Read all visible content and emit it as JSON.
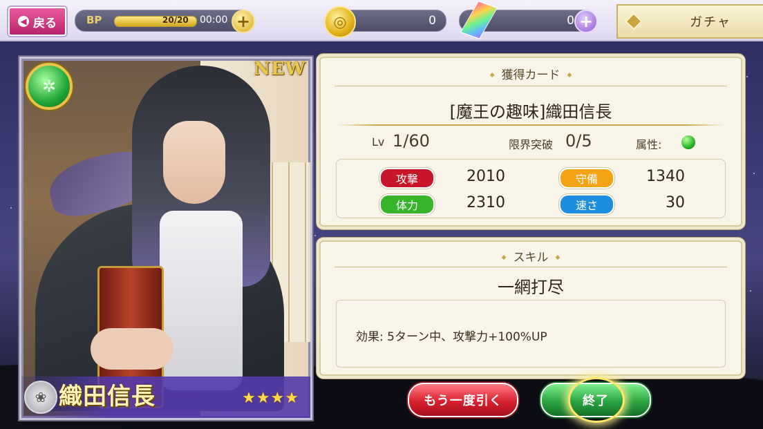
{
  "topbar": {
    "back_label": "戻る",
    "bp_label": "BP",
    "bp_value": "20/20",
    "bp_fraction": 1.0,
    "bp_timer": "00:00",
    "coin_value": "0",
    "gem_value": "0",
    "gacha_label": "ガチャ"
  },
  "card_art": {
    "new_badge": "NEW",
    "character_name": "織田信長",
    "rarity_stars": "★★★★",
    "attribute_color": "#2db52e"
  },
  "acquired_card": {
    "section_title": "獲得カード",
    "card_title": "[魔王の趣味]織田信長",
    "level_label": "Lv",
    "level_value": "1/60",
    "limit_break_label": "限界突破",
    "limit_break_value": "0/5",
    "attribute_label": "属性:",
    "stats": [
      {
        "label": "攻撃",
        "value": "2010",
        "color": "#c8152a"
      },
      {
        "label": "守備",
        "value": "1340",
        "color": "#f2a415"
      },
      {
        "label": "体力",
        "value": "2310",
        "color": "#37b52a"
      },
      {
        "label": "速さ",
        "value": "30",
        "color": "#1d8de0"
      }
    ]
  },
  "skill": {
    "section_title": "スキル",
    "name": "一網打尽",
    "effect": "効果: 5ターン中、攻撃力+100%UP"
  },
  "buttons": {
    "draw_again": "もう一度引く",
    "finish": "終了"
  }
}
